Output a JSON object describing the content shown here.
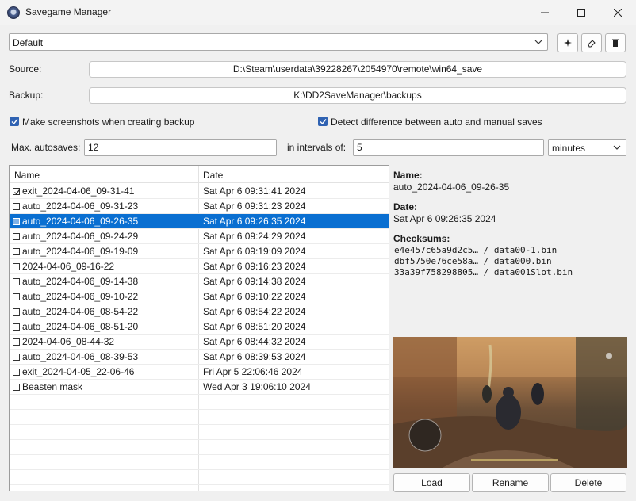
{
  "window": {
    "title": "Savegame Manager"
  },
  "profile": {
    "selected": "Default"
  },
  "toolbar": {
    "new_icon": "sparkle-add-icon",
    "rename_icon": "eraser-icon",
    "delete_icon": "trash-icon"
  },
  "paths": {
    "source_label": "Source:",
    "source_value": "D:\\Steam\\userdata\\39228267\\2054970\\remote\\win64_save",
    "backup_label": "Backup:",
    "backup_value": "K:\\DD2SaveManager\\backups"
  },
  "options": {
    "screenshots_label": "Make screenshots when creating backup",
    "screenshots_checked": true,
    "detect_label": "Detect difference between auto and manual saves",
    "detect_checked": true
  },
  "autosave": {
    "max_label": "Max. autosaves:",
    "max_value": "12",
    "interval_label": "in intervals of:",
    "interval_value": "5",
    "unit_value": "minutes"
  },
  "list": {
    "col_name": "Name",
    "col_date": "Date",
    "rows": [
      {
        "name": "exit_2024-04-06_09-31-41",
        "date": "Sat Apr  6 09:31:41 2024",
        "checked": true,
        "selected": false
      },
      {
        "name": "auto_2024-04-06_09-31-23",
        "date": "Sat Apr  6 09:31:23 2024",
        "checked": false,
        "selected": false
      },
      {
        "name": "auto_2024-04-06_09-26-35",
        "date": "Sat Apr  6 09:26:35 2024",
        "checked": false,
        "selected": true
      },
      {
        "name": "auto_2024-04-06_09-24-29",
        "date": "Sat Apr  6 09:24:29 2024",
        "checked": false,
        "selected": false
      },
      {
        "name": "auto_2024-04-06_09-19-09",
        "date": "Sat Apr  6 09:19:09 2024",
        "checked": false,
        "selected": false
      },
      {
        "name": "2024-04-06_09-16-22",
        "date": "Sat Apr  6 09:16:23 2024",
        "checked": false,
        "selected": false
      },
      {
        "name": "auto_2024-04-06_09-14-38",
        "date": "Sat Apr  6 09:14:38 2024",
        "checked": false,
        "selected": false
      },
      {
        "name": "auto_2024-04-06_09-10-22",
        "date": "Sat Apr  6 09:10:22 2024",
        "checked": false,
        "selected": false
      },
      {
        "name": "auto_2024-04-06_08-54-22",
        "date": "Sat Apr  6 08:54:22 2024",
        "checked": false,
        "selected": false
      },
      {
        "name": "auto_2024-04-06_08-51-20",
        "date": "Sat Apr  6 08:51:20 2024",
        "checked": false,
        "selected": false
      },
      {
        "name": "2024-04-06_08-44-32",
        "date": "Sat Apr  6 08:44:32 2024",
        "checked": false,
        "selected": false
      },
      {
        "name": "auto_2024-04-06_08-39-53",
        "date": "Sat Apr  6 08:39:53 2024",
        "checked": false,
        "selected": false
      },
      {
        "name": "exit_2024-04-05_22-06-46",
        "date": "Fri Apr  5 22:06:46 2024",
        "checked": false,
        "selected": false
      },
      {
        "name": "Beasten mask",
        "date": "Wed Apr  3 19:06:10 2024",
        "checked": false,
        "selected": false
      }
    ]
  },
  "details": {
    "name_label": "Name:",
    "name_value": "auto_2024-04-06_09-26-35",
    "date_label": "Date:",
    "date_value": "Sat Apr  6 09:26:35 2024",
    "checksums_label": "Checksums:",
    "checksums": [
      "e4e457c65a9d2c5… / data00-1.bin",
      "dbf5750e76ce58a… / data000.bin",
      "33a39f758298805… / data001Slot.bin"
    ]
  },
  "actions": {
    "load": "Load",
    "rename": "Rename",
    "delete": "Delete"
  },
  "colors": {
    "accent": "#0a6fd1",
    "checkbox": "#2f62b2"
  }
}
